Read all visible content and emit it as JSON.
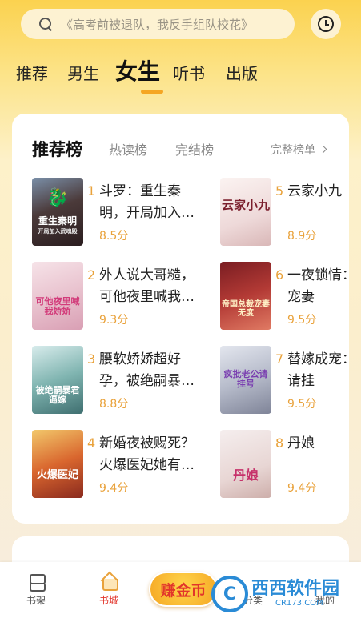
{
  "search": {
    "placeholder": "《高考前被退队，我反手组队校花》"
  },
  "tabs": [
    "推荐",
    "男生",
    "女生",
    "听书",
    "出版"
  ],
  "active_tab": "女生",
  "card": {
    "title": "推荐榜",
    "sub_tabs": [
      "热读榜",
      "完结榜"
    ],
    "more_label": "完整榜单",
    "books": [
      {
        "rank": "1",
        "title": "斗罗：重生秦明，开局加入…",
        "score": "8.5分",
        "cover_text": "重生秦明",
        "cover_sub": "开局加入武魂殿"
      },
      {
        "rank": "2",
        "title": "外人说大哥糙，可他夜里喊我…",
        "score": "9.3分",
        "cover_text": "可他夜里喊我娇娇"
      },
      {
        "rank": "3",
        "title": "腰软娇娇超好孕，被绝嗣暴…",
        "score": "8.8分",
        "cover_text": "被绝嗣暴君逼嫁"
      },
      {
        "rank": "4",
        "title": "新婚夜被赐死？火爆医妃她有…",
        "score": "9.4分",
        "cover_text": "火爆医妃"
      },
      {
        "rank": "5",
        "title": "云家小九",
        "score": "8.9分",
        "cover_text": "云家小九"
      },
      {
        "rank": "6",
        "title": "一夜锁情：总裁宠妻",
        "score": "9.5分",
        "cover_text": "帝国总裁宠妻无度"
      },
      {
        "rank": "7",
        "title": "替嫁成宠：老公请挂",
        "score": "9.5分",
        "cover_text": "疯批老公请挂号"
      },
      {
        "rank": "8",
        "title": "丹娘",
        "score": "9.4分",
        "cover_text": "丹娘"
      }
    ]
  },
  "bottom_nav": {
    "items": [
      "书架",
      "书城",
      "分类",
      "我的"
    ],
    "earn_label": "赚金币"
  },
  "watermark": {
    "logo": "C",
    "main": "西西软件园",
    "sub": "CR173.COM"
  },
  "colors": {
    "accent": "#f5a623",
    "score": "#e9a23b"
  }
}
